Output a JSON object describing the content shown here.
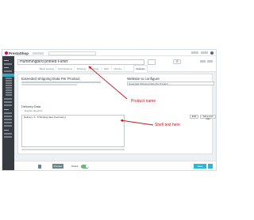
{
  "brand": "PrestaShop",
  "product": {
    "name_value": "Hummingbird printed t-shirt"
  },
  "tabs": [
    "Basic settings",
    "Combinations",
    "Shipping",
    "Pricing",
    "SEO",
    "Options",
    "Modules"
  ],
  "module": {
    "panel_title": "Extended Shipping Data Per Product",
    "website_label": "Website to configure",
    "website_value": "Extended Shipping Data Per Product",
    "delivery_label": "Delivery Data",
    "delivery_sub": "English (English)",
    "edit_label": "Edit",
    "save_label": "Save and stay",
    "textarea_value": "Delivery: 3 - 5 Working days (Germany)"
  },
  "footer": {
    "preview_label": "Preview",
    "online_label": "Online",
    "save_label": "Save"
  },
  "annotations": {
    "product_name": "Product name",
    "edit_text": "Shell text here"
  },
  "colors": {
    "annotation": "#c8141a",
    "accent": "#25b9d7",
    "sidebar": "#363a41"
  }
}
